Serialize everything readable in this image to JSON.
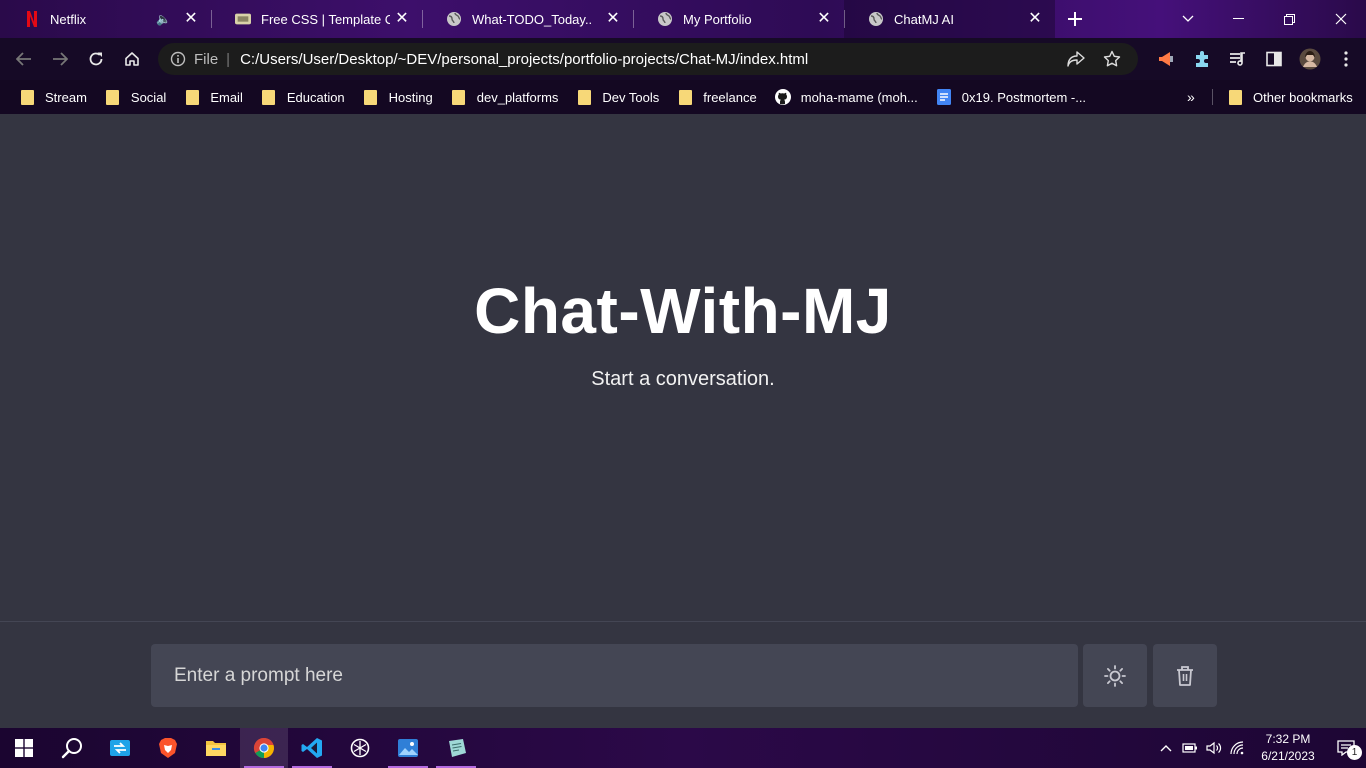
{
  "browser": {
    "tabs": [
      {
        "title": "Netflix",
        "icon": "netflix-icon",
        "audio": true,
        "active": false
      },
      {
        "title": "Free CSS | Template Cat",
        "icon": "template-icon",
        "audio": false,
        "active": false
      },
      {
        "title": "What-TODO_Today..",
        "icon": "globe-icon",
        "audio": false,
        "active": false
      },
      {
        "title": "My Portfolio",
        "icon": "globe-icon",
        "audio": false,
        "active": false
      },
      {
        "title": "ChatMJ AI",
        "icon": "globe-icon",
        "audio": false,
        "active": true
      }
    ],
    "omnibox": {
      "scheme": "File",
      "url": "C:/Users/User/Desktop/~DEV/personal_projects/portfolio-projects/Chat-MJ/index.html"
    },
    "bookmarks": [
      {
        "label": "Stream",
        "type": "folder"
      },
      {
        "label": "Social",
        "type": "folder"
      },
      {
        "label": "Email",
        "type": "folder"
      },
      {
        "label": "Education",
        "type": "folder"
      },
      {
        "label": "Hosting",
        "type": "folder"
      },
      {
        "label": "dev_platforms",
        "type": "folder"
      },
      {
        "label": "Dev Tools",
        "type": "folder"
      },
      {
        "label": "freelance",
        "type": "folder"
      },
      {
        "label": "moha-mame (moh...",
        "type": "github"
      },
      {
        "label": "0x19. Postmortem -...",
        "type": "doc"
      }
    ],
    "more_bookmarks": "»",
    "other_bookmarks": "Other bookmarks"
  },
  "page": {
    "title": "Chat-With-MJ",
    "subtitle": "Start a conversation.",
    "prompt_placeholder": "Enter a prompt here",
    "theme_button_icon": "sun-icon",
    "delete_button_icon": "trash-icon"
  },
  "taskbar": {
    "time": "7:32 PM",
    "date": "6/21/2023",
    "notification_count": "1"
  },
  "colors": {
    "page_bg": "#343541",
    "input_bg": "#444654",
    "accent": "#b46be0"
  }
}
